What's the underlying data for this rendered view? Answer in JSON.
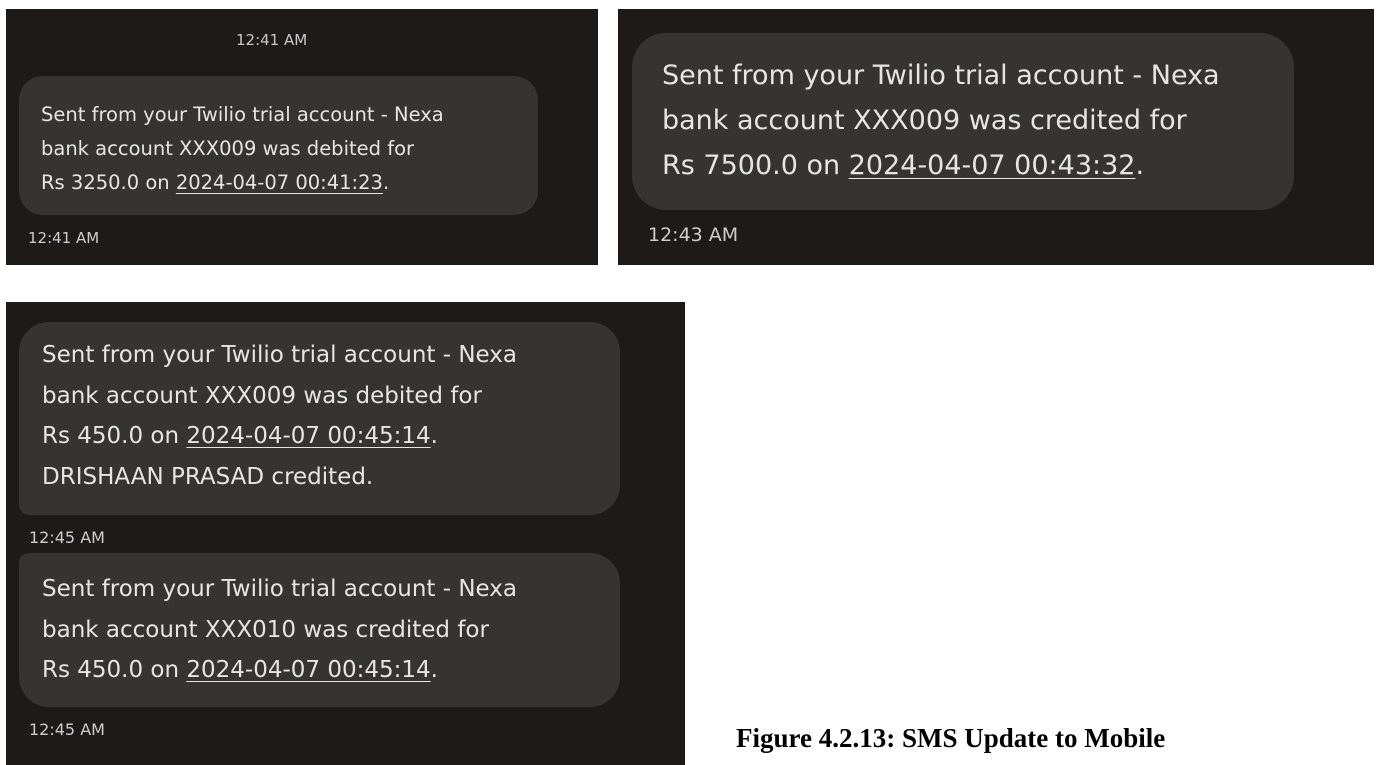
{
  "panels": [
    {
      "top_time": "12:41 AM",
      "message": {
        "lines": [
          "Sent from your Twilio trial account - Nexa",
          "bank account XXX009 was debited for"
        ],
        "amount_prefix": "Rs 3250.0 on ",
        "date": "2024-04-07 00:41:23",
        "suffix": "."
      },
      "time": "12:41 AM"
    },
    {
      "message": {
        "lines": [
          "Sent from your Twilio trial account - Nexa",
          "bank account XXX009 was credited for"
        ],
        "amount_prefix": "Rs 7500.0 on ",
        "date": "2024-04-07 00:43:32",
        "suffix": "."
      },
      "time": "12:43 AM"
    },
    {
      "messages": [
        {
          "lines": [
            "Sent from your Twilio trial account - Nexa",
            "bank account XXX009 was debited for"
          ],
          "amount_prefix": "Rs 450.0 on ",
          "date": "2024-04-07 00:45:14",
          "suffix": ".",
          "extra_line": "DRISHAAN PRASAD credited.",
          "time": "12:45 AM"
        },
        {
          "lines": [
            "Sent from your Twilio trial account - Nexa",
            "bank account XXX010 was credited for"
          ],
          "amount_prefix": "Rs 450.0 on ",
          "date": "2024-04-07 00:45:14",
          "suffix": ".",
          "time": "12:45 AM"
        }
      ]
    }
  ],
  "caption": "Figure 4.2.13: SMS Update to Mobile",
  "colors": {
    "panel_bg": "#1c1b1a",
    "bubble_bg": "#353432",
    "text": "#e7e5e2",
    "timestamp": "#cfcdca"
  }
}
